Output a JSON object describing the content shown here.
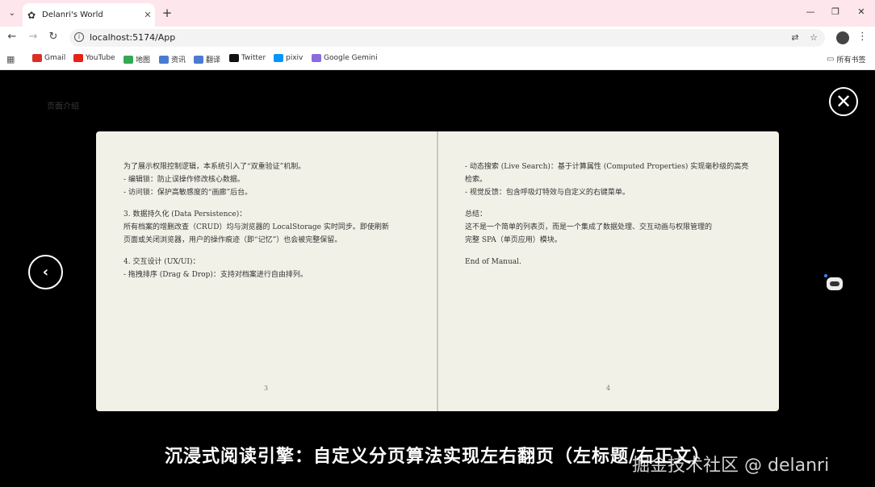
{
  "browser": {
    "tab_title": "Delanri's World",
    "url": "localhost:5174/App",
    "bookmarks": [
      {
        "label": "Gmail",
        "icon": "gmail-icon",
        "color": "#d93025"
      },
      {
        "label": "YouTube",
        "icon": "youtube-icon",
        "color": "#e62117"
      },
      {
        "label": "地图",
        "icon": "maps-icon",
        "color": "#34a853"
      },
      {
        "label": "资讯",
        "icon": "news-icon",
        "color": "#4a7bd0"
      },
      {
        "label": "翻译",
        "icon": "translate-icon",
        "color": "#4a7bd0"
      },
      {
        "label": "Twitter",
        "icon": "x-icon",
        "color": "#111111"
      },
      {
        "label": "pixiv",
        "icon": "pixiv-icon",
        "color": "#0096fa"
      },
      {
        "label": "Google Gemini",
        "icon": "gemini-icon",
        "color": "#8a6be0"
      }
    ],
    "all_bookmarks": "所有书签"
  },
  "page": {
    "intro_label": "页面介绍",
    "close_icon": "close-icon",
    "prev_symbol": "‹",
    "caption": "沉浸式阅读引擎：自定义分页算法实现左右翻页（左标题/右正文）",
    "watermark": "掘金技术社区 @ delanri"
  },
  "book": {
    "left": {
      "para1": [
        "为了展示权限控制逻辑，本系统引入了“双重验证”机制。",
        "- 编辑锁：防止误操作修改核心数据。",
        "- 访问锁：保护高敏感度的“画廊”后台。"
      ],
      "para2": [
        "3. 数据持久化 (Data Persistence)：",
        "所有档案的增删改查（CRUD）均与浏览器的 LocalStorage 实时同步。即使刷新",
        "页面或关闭浏览器，用户的操作痕迹（即“记忆”）也会被完整保留。"
      ],
      "para3": [
        "4. 交互设计 (UX/UI)：",
        "- 拖拽排序 (Drag & Drop)：支持对档案进行自由排列。"
      ],
      "page_number": "3"
    },
    "right": {
      "para1": [
        "- 动态搜索 (Live Search)：基于计算属性 (Computed Properties) 实现毫秒级的高亮",
        "检索。",
        "- 视觉反馈：包含呼吸灯特效与自定义的右键菜单。"
      ],
      "para2": [
        "总结：",
        "这不是一个简单的列表页，而是一个集成了数据处理、交互动画与权限管理的",
        "完整 SPA（单页应用）模块。"
      ],
      "para3": [
        "End of Manual."
      ],
      "page_number": "4"
    }
  }
}
